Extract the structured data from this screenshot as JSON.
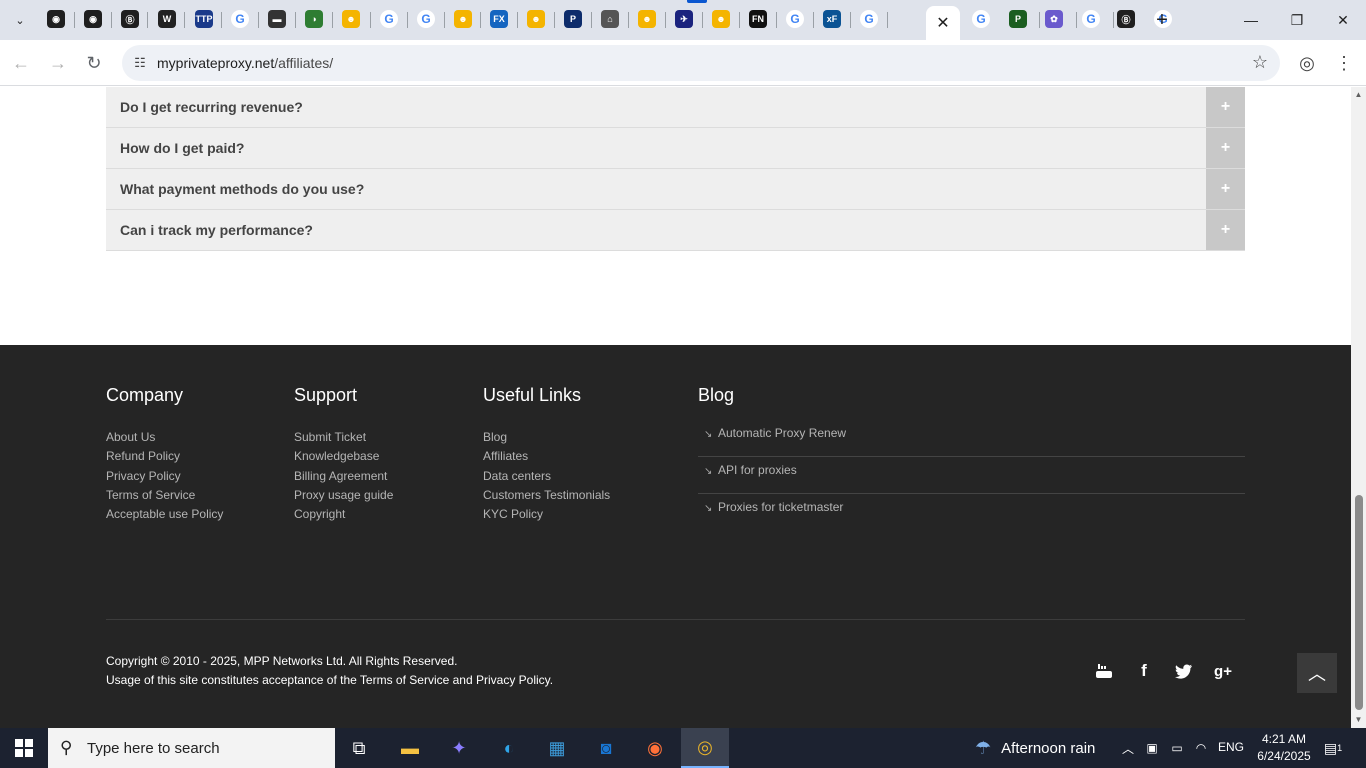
{
  "browser": {
    "url_domain": "myprivateproxy.net",
    "url_path": "/affiliates/",
    "tab_close_glyph": "✕",
    "new_tab_glyph": "+",
    "tab_favicons": [
      "◉",
      "◉",
      "Ⓑ",
      "W",
      "TTP",
      "G",
      "▬",
      "◑",
      "☻",
      "G",
      "G",
      "☻",
      "FX",
      "☻",
      "P",
      "⌂",
      "☻",
      "✈",
      "☻",
      "FN",
      "G",
      "xF",
      "G",
      "✕",
      "G",
      "P",
      "✿",
      "G",
      "Ⓑ",
      "G"
    ],
    "window_controls": {
      "minimize": "—",
      "maximize": "❐",
      "close": "✕"
    }
  },
  "faq": {
    "items": [
      {
        "question": "Do I get recurring revenue?"
      },
      {
        "question": "How do I get paid?"
      },
      {
        "question": "What payment methods do you use?"
      },
      {
        "question": "Can i track my performance?"
      }
    ],
    "expand_glyph": "+"
  },
  "footer": {
    "company": {
      "heading": "Company",
      "links": [
        "About Us",
        "Refund Policy",
        "Privacy Policy",
        "Terms of Service",
        "Acceptable use Policy"
      ]
    },
    "support": {
      "heading": "Support",
      "links": [
        "Submit Ticket",
        "Knowledgebase",
        "Billing Agreement",
        "Proxy usage guide",
        "Copyright"
      ]
    },
    "useful": {
      "heading": "Useful Links",
      "links": [
        "Blog",
        "Affiliates",
        "Data centers",
        "Customers Testimonials",
        "KYC Policy"
      ]
    },
    "blog": {
      "heading": "Blog",
      "posts": [
        "Automatic Proxy Renew",
        "API for proxies",
        "Proxies for ticketmaster"
      ]
    },
    "copyright_line1": "Copyright © 2010 - 2025, MPP Networks Ltd. All Rights Reserved.",
    "copyright_line2": "Usage of this site constitutes acceptance of the Terms of Service and Privacy Policy."
  },
  "taskbar": {
    "search_placeholder": "Type here to search",
    "weather": "Afternoon rain",
    "language": "ENG",
    "time": "4:21 AM",
    "date": "6/24/2025",
    "notification_count": "1"
  }
}
